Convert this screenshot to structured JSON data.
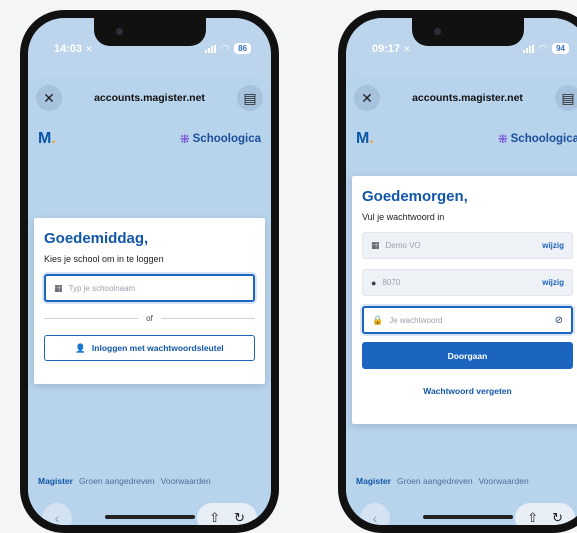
{
  "left": {
    "status": {
      "time": "14:03",
      "battery": "86"
    },
    "browser": {
      "url": "accounts.magister.net"
    },
    "brand": {
      "magister": "M",
      "schoologica": "Schoologica"
    },
    "card": {
      "heading": "Goedemiddag,",
      "subtitle": "Kies je school om in te loggen",
      "school_placeholder": "Typ je schoolnaam",
      "divider": "of",
      "passkey_button": "Inloggen met wachtwoordsleutel"
    },
    "footer": {
      "magister": "Magister",
      "green": "Groen aangedreven",
      "terms": "Voorwaarden"
    }
  },
  "right": {
    "status": {
      "time": "09:17",
      "battery": "94"
    },
    "browser": {
      "url": "accounts.magister.net"
    },
    "brand": {
      "magister": "M",
      "schoologica": "Schoologica"
    },
    "card": {
      "heading": "Goedemorgen,",
      "subtitle": "Vul je wachtwoord in",
      "school_value": "Demo VO",
      "user_value": "8070",
      "edit_label": "wijzig",
      "password_placeholder": "Je wachtwoord",
      "submit": "Doorgaan",
      "forgot": "Wachtwoord vergeten"
    },
    "footer": {
      "magister": "Magister",
      "green": "Groen aangedreven",
      "terms": "Voorwaarden"
    }
  },
  "icons": {
    "close": "close-icon",
    "tabs": "tabs-icon",
    "school": "school-icon",
    "user": "user-icon",
    "lock": "lock-icon",
    "eye": "eye-slash-icon",
    "passkey": "passkey-icon",
    "back": "chevron-left-icon",
    "share": "share-icon",
    "reload": "reload-icon"
  },
  "colors": {
    "accent": "#1b64bf",
    "background": "#bcd5ec",
    "heading": "#1257a8"
  }
}
